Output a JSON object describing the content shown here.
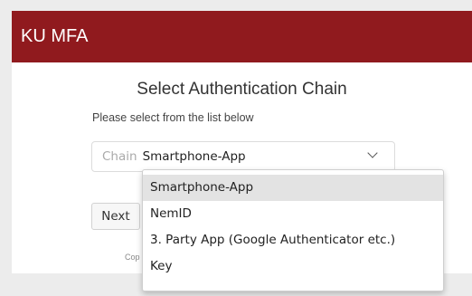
{
  "header": {
    "brand": "KU MFA"
  },
  "main": {
    "title": "Select Authentication Chain",
    "instructions": "Please select from the list below",
    "select": {
      "label": "Chain",
      "value": "Smartphone-App",
      "options": [
        "Smartphone-App",
        "NemID",
        "3. Party App (Google Authenticator etc.)",
        "Key"
      ]
    },
    "next_label": "Next",
    "footer_text": "Cop"
  },
  "colors": {
    "brand": "#901a1e",
    "background": "#ececec",
    "selected_option": "#e3e3e3"
  }
}
